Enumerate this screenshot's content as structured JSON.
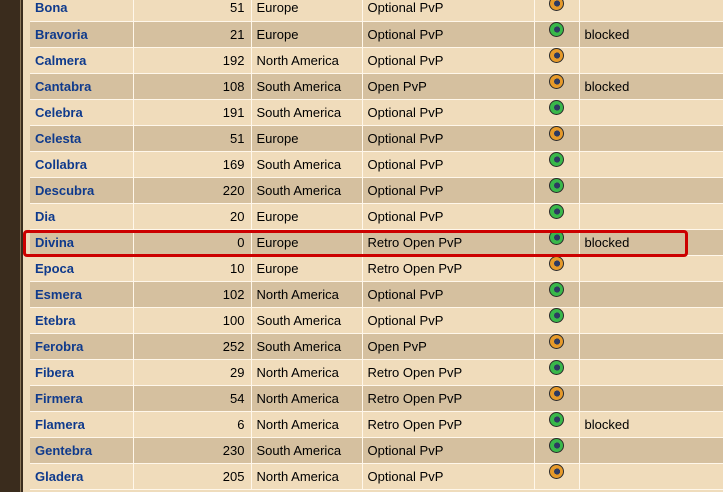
{
  "worlds": [
    {
      "name": "Bona",
      "players": "51",
      "location": "Europe",
      "pvp": "Optional PvP",
      "premium_icon": "globe-orange-icon",
      "status": ""
    },
    {
      "name": "Bravoria",
      "players": "21",
      "location": "Europe",
      "pvp": "Optional PvP",
      "premium_icon": "globe-green-icon",
      "status": "blocked"
    },
    {
      "name": "Calmera",
      "players": "192",
      "location": "North America",
      "pvp": "Optional PvP",
      "premium_icon": "globe-orange-icon",
      "status": ""
    },
    {
      "name": "Cantabra",
      "players": "108",
      "location": "South America",
      "pvp": "Open PvP",
      "premium_icon": "globe-orange-icon",
      "status": "blocked"
    },
    {
      "name": "Celebra",
      "players": "191",
      "location": "South America",
      "pvp": "Optional PvP",
      "premium_icon": "globe-green-icon",
      "status": ""
    },
    {
      "name": "Celesta",
      "players": "51",
      "location": "Europe",
      "pvp": "Optional PvP",
      "premium_icon": "globe-orange-icon",
      "status": ""
    },
    {
      "name": "Collabra",
      "players": "169",
      "location": "South America",
      "pvp": "Optional PvP",
      "premium_icon": "globe-green-icon",
      "status": ""
    },
    {
      "name": "Descubra",
      "players": "220",
      "location": "South America",
      "pvp": "Optional PvP",
      "premium_icon": "globe-green-icon",
      "status": ""
    },
    {
      "name": "Dia",
      "players": "20",
      "location": "Europe",
      "pvp": "Optional PvP",
      "premium_icon": "globe-green-icon",
      "status": ""
    },
    {
      "name": "Divina",
      "players": "0",
      "location": "Europe",
      "pvp": "Retro Open PvP",
      "premium_icon": "globe-green-icon",
      "status": "blocked"
    },
    {
      "name": "Epoca",
      "players": "10",
      "location": "Europe",
      "pvp": "Retro Open PvP",
      "premium_icon": "globe-orange-icon",
      "status": ""
    },
    {
      "name": "Esmera",
      "players": "102",
      "location": "North America",
      "pvp": "Optional PvP",
      "premium_icon": "globe-green-icon",
      "status": ""
    },
    {
      "name": "Etebra",
      "players": "100",
      "location": "South America",
      "pvp": "Optional PvP",
      "premium_icon": "globe-green-icon",
      "status": ""
    },
    {
      "name": "Ferobra",
      "players": "252",
      "location": "South America",
      "pvp": "Open PvP",
      "premium_icon": "globe-orange-icon",
      "status": ""
    },
    {
      "name": "Fibera",
      "players": "29",
      "location": "North America",
      "pvp": "Retro Open PvP",
      "premium_icon": "globe-green-icon",
      "status": ""
    },
    {
      "name": "Firmera",
      "players": "54",
      "location": "North America",
      "pvp": "Retro Open PvP",
      "premium_icon": "globe-orange-icon",
      "status": ""
    },
    {
      "name": "Flamera",
      "players": "6",
      "location": "North America",
      "pvp": "Retro Open PvP",
      "premium_icon": "globe-green-icon",
      "status": "blocked"
    },
    {
      "name": "Gentebra",
      "players": "230",
      "location": "South America",
      "pvp": "Optional PvP",
      "premium_icon": "globe-green-icon",
      "status": ""
    },
    {
      "name": "Gladera",
      "players": "205",
      "location": "North America",
      "pvp": "Optional PvP",
      "premium_icon": "globe-orange-icon",
      "status": ""
    }
  ],
  "highlighted_world": "Divina",
  "colors": {
    "row_light": "#f0dcbb",
    "row_dark": "#d5c09f",
    "link": "#0f3a8c",
    "highlight": "#cc0000",
    "globe_green": "#39b84a",
    "globe_orange": "#e69a2a"
  }
}
